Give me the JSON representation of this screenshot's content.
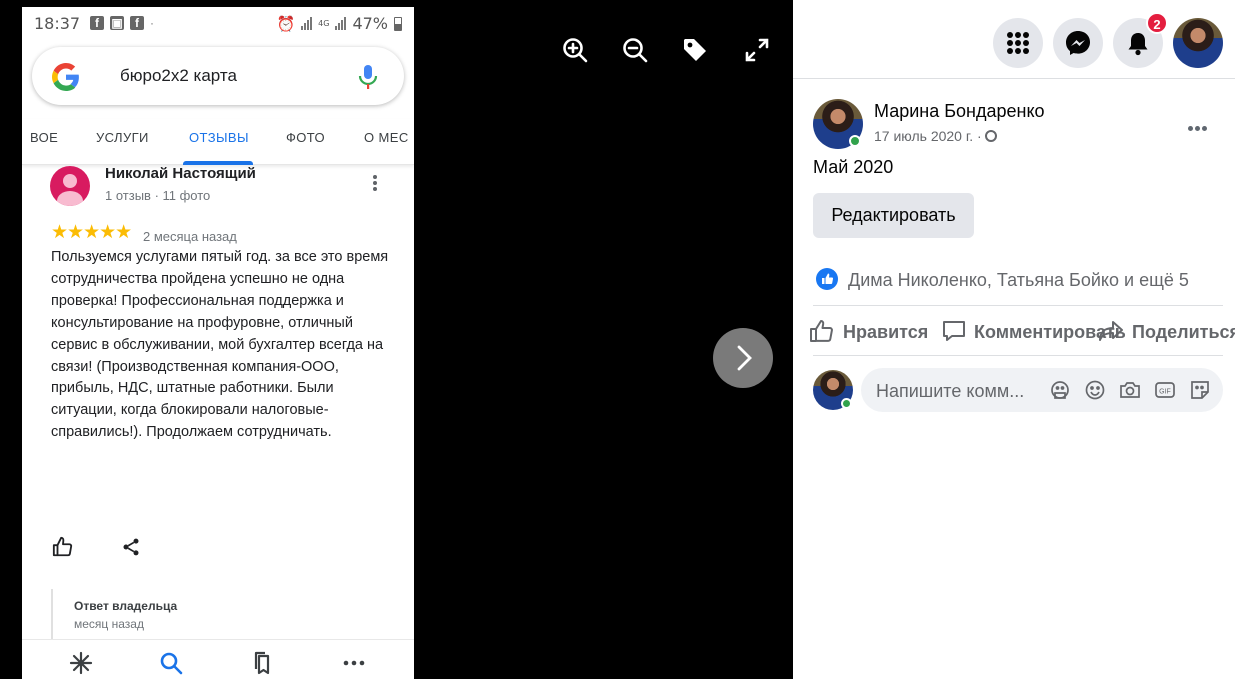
{
  "phone": {
    "status_time": "18:37",
    "status_net": "4G",
    "status_battery": "47%",
    "search_query": "бюро2x2 карта",
    "google_letter": "G",
    "tabs": [
      "ВОЕ",
      "УСЛУГИ",
      "ОТЗЫВЫ",
      "ФОТО",
      "О МЕС"
    ],
    "active_tab": "ОТЗЫВЫ",
    "review": {
      "author": "Николай Настоящий",
      "meta": "1 отзыв · 11 фото",
      "rating": 5,
      "stars": "★★★★★",
      "ago": "2 месяца назад",
      "text": "Пользуемся услугами пятый год. за все это время сотрудничества пройдена успешно не одна проверка! Профессиональная поддержка и консультирование на профуровне, отличный сервис в обслуживании, мой бухгалтер всегда на связи! (Производственная компания-ООО, прибыль, НДС, штатные работники. Были ситуации, когда блокировали налоговые-справились!). Продолжаем сотрудничать."
    },
    "owner_reply": {
      "title": "Ответ владельца",
      "ago": "месяц назад"
    },
    "bottom_nav": [
      "asterisk-icon",
      "search-icon",
      "bookmarks-icon",
      "more-icon"
    ]
  },
  "viewer": {
    "icons": [
      "zoom-in-icon",
      "zoom-out-icon",
      "tag-icon",
      "fullscreen-icon"
    ]
  },
  "facebook": {
    "notification_count": "2",
    "post": {
      "author": "Марина Бондаренко",
      "date": "17 июль 2020 г. ·",
      "text": "Май 2020",
      "edit_label": "Редактировать",
      "reactors": "Дима Николенко, Татьяна Бойко и ещё 5",
      "like_label": "Нравится",
      "comment_label": "Комментировать",
      "share_label": "Поделиться",
      "comment_placeholder": "Напишите комм..."
    }
  },
  "colors": {
    "google_blue": "#1a73e8",
    "star_yellow": "#fbbc04",
    "fb_blue": "#1877f2",
    "fb_red_badge": "#e41e3f"
  }
}
